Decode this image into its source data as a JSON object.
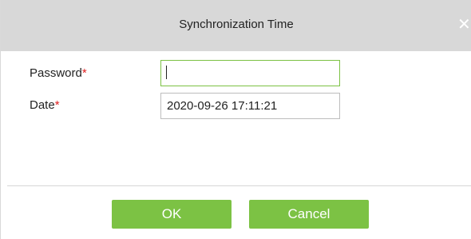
{
  "dialog": {
    "title": "Synchronization Time",
    "close_glyph": "✕"
  },
  "form": {
    "password_label": "Password",
    "password_value": "",
    "date_label": "Date",
    "date_value": "2020-09-26 17:11:21",
    "required_mark": "*"
  },
  "buttons": {
    "ok_label": "OK",
    "cancel_label": "Cancel"
  },
  "colors": {
    "accent": "#7cc244",
    "titlebar": "#d8d8d8",
    "required": "#e02020"
  }
}
